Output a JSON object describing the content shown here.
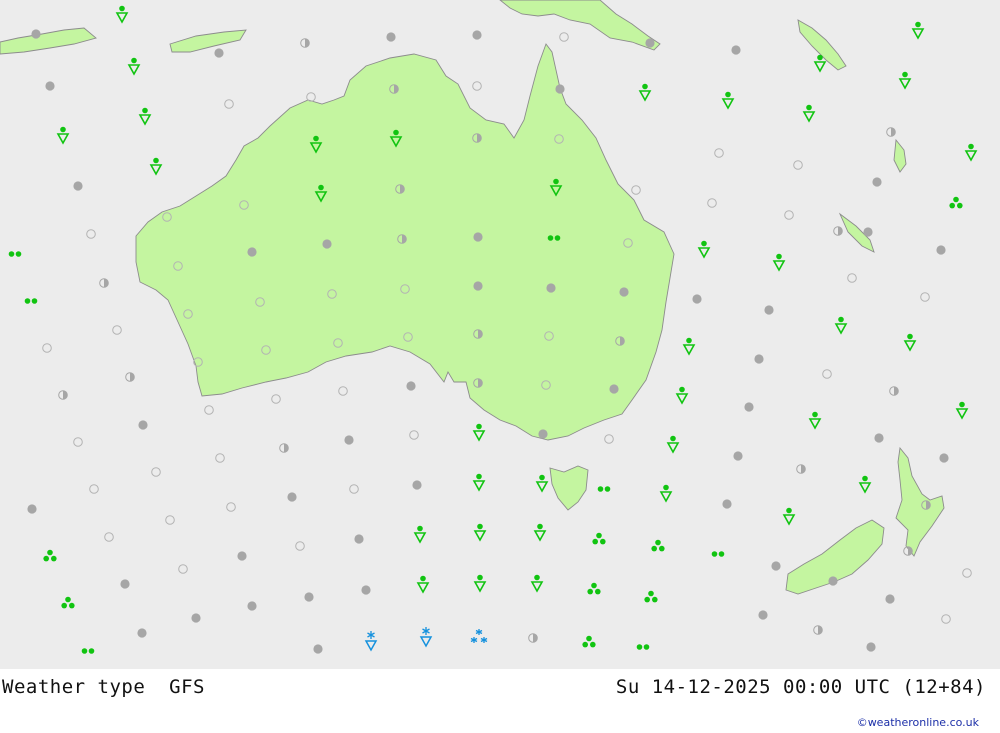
{
  "footer": {
    "label": "Weather type",
    "model": "GFS",
    "datetime": "Su 14-12-2025 00:00 UTC (12+84)",
    "credit": "©weatheronline.co.uk"
  },
  "colors": {
    "sea": "#ececec",
    "land": "#c4f5a0",
    "coast": "#8c8c8c",
    "rain": "#11c411",
    "snow": "#1591dd",
    "cloud": "#a6a6a6"
  },
  "legend_of_symbols": {
    "overcast": "filled-grey-circle",
    "partly-cloudy": "half-filled-circle",
    "clear": "open-circle",
    "drizzle": "two-green-dots",
    "rain": "three-green-dots",
    "rain-shower": "green-dot-over-triangle",
    "snow-shower": "blue-star-over-triangle",
    "snow": "three-blue-stars"
  }
}
